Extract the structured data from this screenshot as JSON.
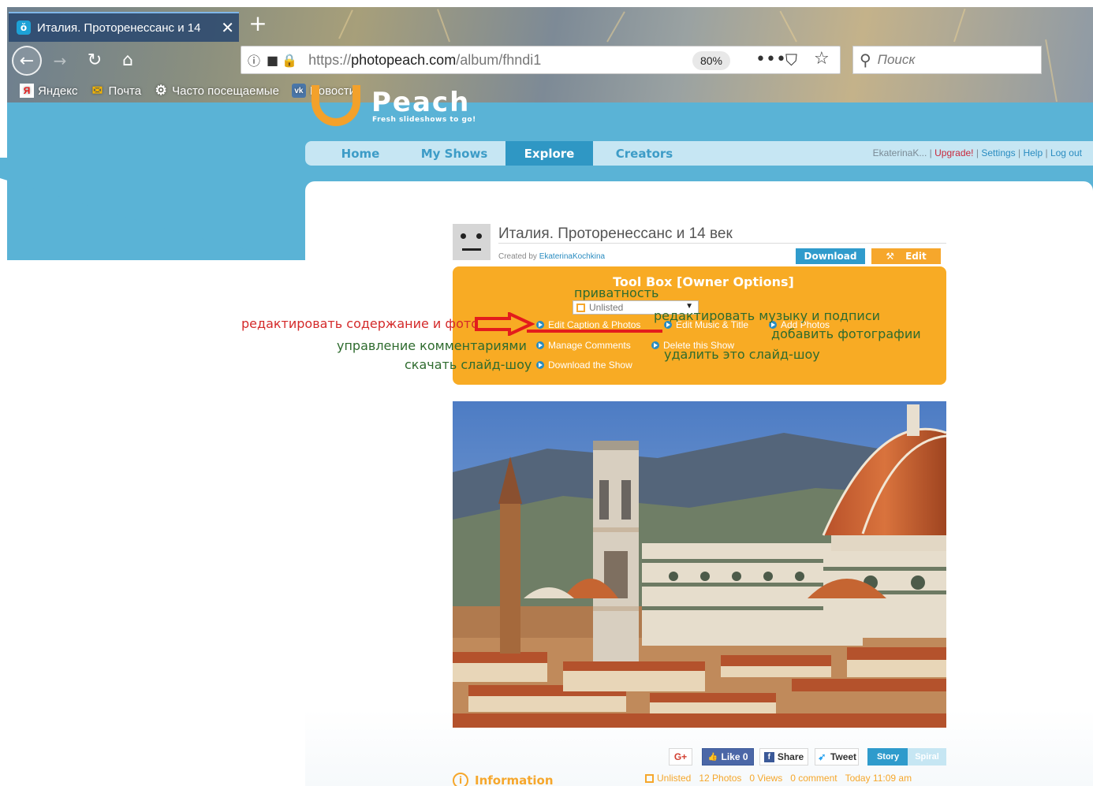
{
  "browser": {
    "tab_title": "Италия. Проторенессанс и 14",
    "url_prefix": "https://",
    "url_domain": "photopeach.com",
    "url_path": "/album/fhndi1",
    "zoom": "80%",
    "search_placeholder": "Поиск",
    "bookmarks": [
      "Яндекс",
      "Почта",
      "Часто посещаемые",
      "Новости"
    ]
  },
  "site": {
    "logo_text": "Peach",
    "logo_tagline": "Fresh slideshows to go!",
    "nav": [
      "Home",
      "My Shows",
      "Explore",
      "Creators"
    ],
    "user_name": "EkaterinaK...",
    "links": [
      "Upgrade!",
      "Settings",
      "Help",
      "Log out"
    ]
  },
  "show": {
    "title": "Италия. Проторенессанс и 14 век",
    "created_by_label": "Created by",
    "author": "EkaterinaKochkina",
    "download_label": "Download",
    "edit_label": "Edit"
  },
  "toolbox": {
    "title": "Tool Box [Owner Options]",
    "privacy_value": "Unlisted",
    "options": [
      "Edit Caption & Photos",
      "Edit Music & Title",
      "Add Photos",
      "Manage Comments",
      "Delete this Show",
      "Download the Show"
    ]
  },
  "annotations": {
    "privacy": "приватность",
    "edit_content": "редактировать содержание и фото",
    "edit_music": "редактировать музыку и подписи",
    "add_photos": "добавить фотографии",
    "manage_comments": "управление комментариями",
    "delete_show": "удалить это слайд-шоу",
    "download_show": "скачать слайд-шоу"
  },
  "social": {
    "gplus": "G+",
    "like": "Like 0",
    "share": "Share",
    "tweet": "Tweet",
    "story": "Story",
    "spiral": "Spiral"
  },
  "info": {
    "title": "Information",
    "stats": [
      "Unlisted",
      "12 Photos",
      "0 Views",
      "0 comment",
      "Today 11:09 am"
    ]
  },
  "colors": {
    "accent_blue": "#2f97c4",
    "toolbox_orange": "#f8ab24",
    "annotation_red": "#d42a2a",
    "annotation_green": "#2e6b2e"
  }
}
